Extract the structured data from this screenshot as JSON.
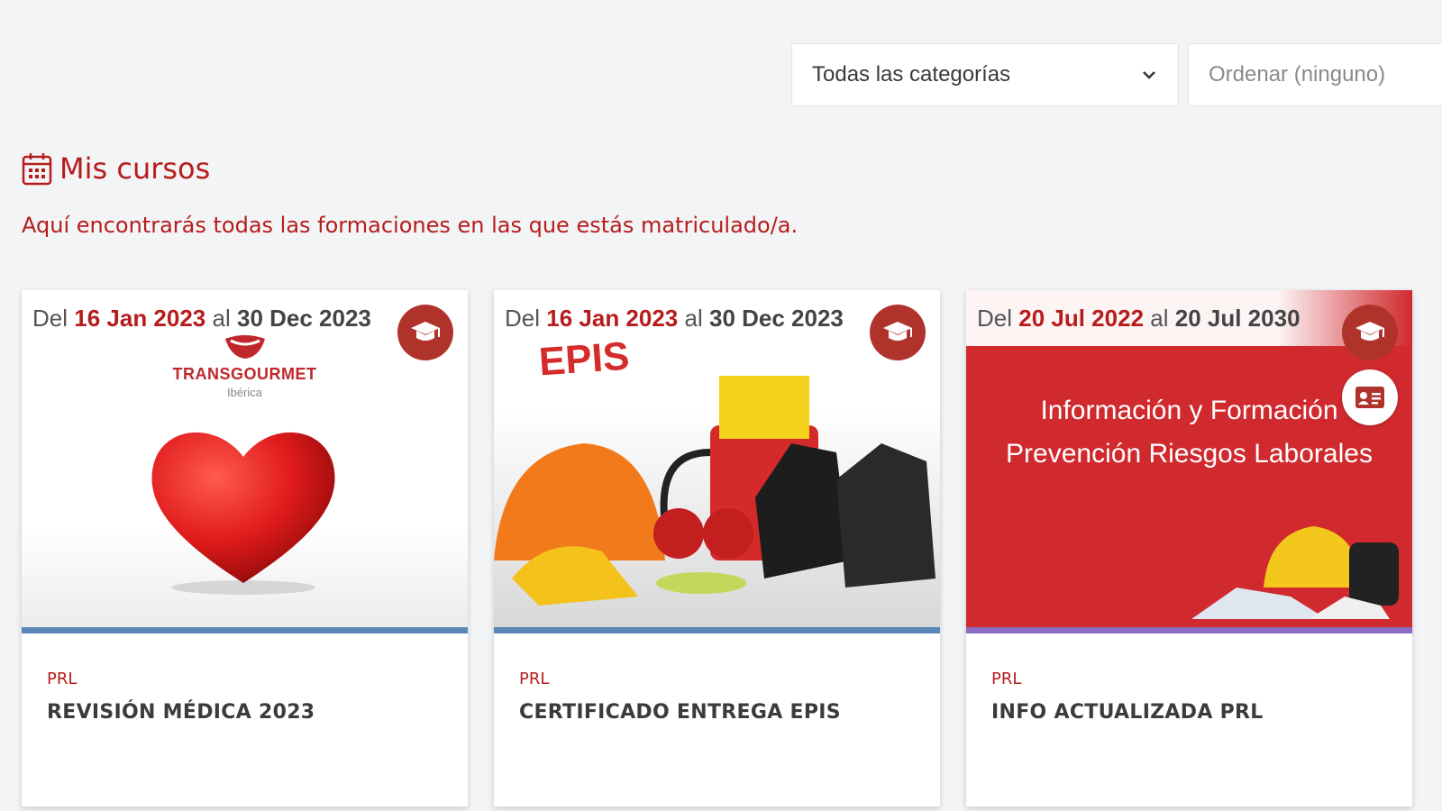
{
  "filters": {
    "category": "Todas las categorías",
    "order": "Ordenar (ninguno)"
  },
  "section": {
    "title": "Mis cursos",
    "subtitle": "Aquí encontrarás todas las formaciones en las que estás matriculado/a."
  },
  "cards": [
    {
      "date_prefix": "Del",
      "start": "16 Jan 2023",
      "date_mid": "al",
      "end": "30 Dec 2023",
      "category": "PRL",
      "title": "REVISIÓN MÉDICA 2023",
      "bar_color": "#5b86b8",
      "logo_word": "TRANSGOURMET",
      "logo_sub": "Ibérica"
    },
    {
      "date_prefix": "Del",
      "start": "16 Jan 2023",
      "date_mid": "al",
      "end": "30 Dec 2023",
      "category": "PRL",
      "title": "CERTIFICADO ENTREGA EPIS",
      "bar_color": "#5b86b8",
      "image_text": "EPIS"
    },
    {
      "date_prefix": "Del",
      "start": "20 Jul 2022",
      "date_mid": "al",
      "end": "20 Jul 2030",
      "category": "PRL",
      "title": "INFO ACTUALIZADA PRL",
      "bar_color": "#8b6bbf",
      "image_line1": "Información y Formación",
      "image_line2": "Prevención Riesgos Laborales"
    }
  ],
  "colors": {
    "accent": "#b71c1c",
    "badge": "#b0332b"
  },
  "icons": {
    "heading": "calendar-icon",
    "badge": "graduation-cap-icon",
    "badge2": "id-card-icon",
    "select": "chevron-down-icon"
  }
}
